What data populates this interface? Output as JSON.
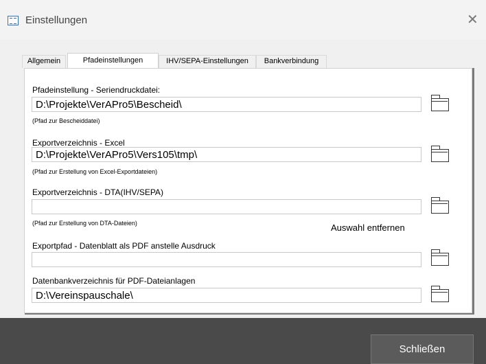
{
  "window": {
    "title": "Einstellungen",
    "close_glyph": "✕",
    "app_icon": "form-icon"
  },
  "tabs": [
    {
      "label": "Allgemein",
      "active": false
    },
    {
      "label": "Pfadeinstellungen",
      "active": true
    },
    {
      "label": "IHV/SEPA-Einstellungen",
      "active": false
    },
    {
      "label": "Bankverbindung",
      "active": false
    }
  ],
  "fields": [
    {
      "label": "Pfadeinstellung - Seriendruckdatei:",
      "value": "D:\\Projekte\\VerAPro5\\Bescheid\\",
      "hint": "(Pfad zur Bescheiddatei)"
    },
    {
      "label": "Exportverzeichnis - Excel",
      "value": "D:\\Projekte\\VerAPro5\\Vers105\\tmp\\",
      "hint": "(Pfad zur Erstellung von Excel-Exportdateien)"
    },
    {
      "label": "Exportverzeichnis - DTA(IHV/SEPA)",
      "value": "",
      "hint": "(Pfad zur Erstellung von DTA-Dateien)"
    },
    {
      "label": "Exportpfad - Datenblatt als PDF anstelle Ausdruck",
      "value": ""
    },
    {
      "label": "Datenbankverzeichnis für PDF-Dateianlagen",
      "value": "D:\\Vereinspauschale\\"
    }
  ],
  "remove_selection_label": "Auswahl entfernen",
  "footer": {
    "close_label": "Schließen"
  },
  "colors": {
    "footer_bg": "#4a4a4a",
    "button_bg": "#5b5b5b",
    "icon_accent": "#2f6fcf"
  }
}
